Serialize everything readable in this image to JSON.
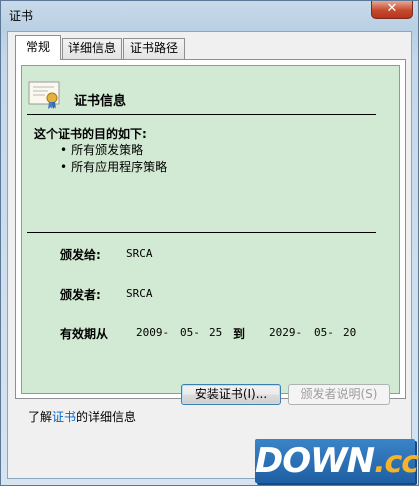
{
  "window": {
    "title": "证书",
    "close_glyph": "✕"
  },
  "tabs": [
    {
      "label": "常规",
      "active": true
    },
    {
      "label": "详细信息",
      "active": false
    },
    {
      "label": "证书路径",
      "active": false
    }
  ],
  "cert": {
    "heading": "证书信息",
    "purpose_title": "这个证书的目的如下:",
    "purposes": [
      "所有颁发策略",
      "所有应用程序策略"
    ],
    "issued_to_label": "颁发给:",
    "issued_to_value": "SRCA",
    "issued_by_label": "颁发者:",
    "issued_by_value": "SRCA",
    "validity_label": "有效期从",
    "valid_from": {
      "year": "2009-",
      "month": "05-",
      "day": "25"
    },
    "to_label": "到",
    "valid_to": {
      "year": "2029-",
      "month": "05-",
      "day": "20"
    }
  },
  "buttons": {
    "install": "安装证书(I)...",
    "issuer_statement": "颁发者说明(S)"
  },
  "more_info": {
    "prefix": "了解",
    "link": "证书",
    "suffix": "的详细信息"
  },
  "watermark": {
    "main": "DOWN",
    "tld": ".cc"
  },
  "icons": {
    "certificate": "certificate-icon",
    "close": "close-icon"
  }
}
